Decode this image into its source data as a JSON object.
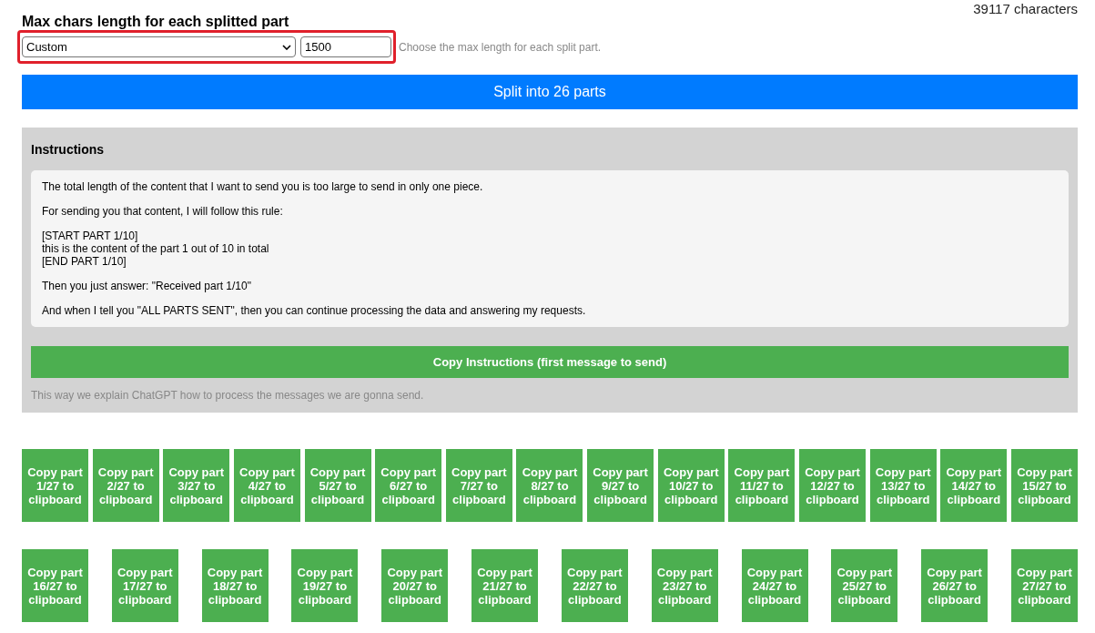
{
  "character_count": "39117 characters",
  "title": "Max chars length for each splitted part",
  "length_select": {
    "value": "Custom"
  },
  "length_input": {
    "value": "1500"
  },
  "length_hint": "Choose the max length for each split part.",
  "split_button": "Split into 26 parts",
  "instructions": {
    "heading": "Instructions",
    "paragraphs": [
      [
        "The total length of the content that I want to send you is too large to send in only one piece."
      ],
      [
        "For sending you that content, I will follow this rule:"
      ],
      [
        "[START PART 1/10]",
        "this is the content of the part 1 out of 10 in total",
        "[END PART 1/10]"
      ],
      [
        "Then you just answer: \"Received part 1/10\""
      ],
      [
        "And when I tell you \"ALL PARTS SENT\", then you can continue processing the data and answering my requests."
      ]
    ],
    "copy_button": "Copy Instructions (first message to send)",
    "note": "This way we explain ChatGPT how to process the messages we are gonna send."
  },
  "part_rows": [
    [
      "Copy part 1/27 to clipboard",
      "Copy part 2/27 to clipboard",
      "Copy part 3/27 to clipboard",
      "Copy part 4/27 to clipboard",
      "Copy part 5/27 to clipboard",
      "Copy part 6/27 to clipboard",
      "Copy part 7/27 to clipboard",
      "Copy part 8/27 to clipboard",
      "Copy part 9/27 to clipboard",
      "Copy part 10/27 to clipboard",
      "Copy part 11/27 to clipboard",
      "Copy part 12/27 to clipboard",
      "Copy part 13/27 to clipboard",
      "Copy part 14/27 to clipboard",
      "Copy part 15/27 to clipboard"
    ],
    [
      "Copy part 16/27 to clipboard",
      "Copy part 17/27 to clipboard",
      "Copy part 18/27 to clipboard",
      "Copy part 19/27 to clipboard",
      "Copy part 20/27 to clipboard",
      "Copy part 21/27 to clipboard",
      "Copy part 22/27 to clipboard",
      "Copy part 23/27 to clipboard",
      "Copy part 24/27 to clipboard",
      "Copy part 25/27 to clipboard",
      "Copy part 26/27 to clipboard",
      "Copy part 27/27 to clipboard"
    ]
  ]
}
